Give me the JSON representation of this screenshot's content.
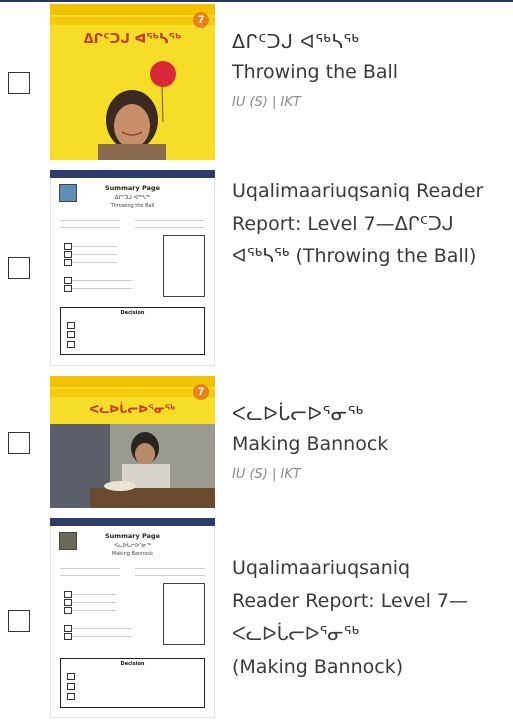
{
  "items": [
    {
      "kind": "book",
      "syllabics": "ᐃᒋᑦᑐᒍ ᐊᖅᓴᖅ",
      "title": "Throwing the Ball",
      "meta": "IU (S) | IKT",
      "cover_title": "ᐃᒋᑦᑐᒍ ᐊᖅᓴᖅ",
      "level": "7",
      "checked": false
    },
    {
      "kind": "report",
      "title": "Uqalimaariuqsaniq Reader Report: Level 7—ᐃᒋᑦᑐᒍ ᐊᖅᓴᖅ (Throwing the Ball)",
      "report_heading": "Summary Page",
      "report_syllabics": "ᐃᒋᑦᑐᒍ ᐊᖅᓴᖅ",
      "report_english": "Throwing the Ball",
      "decision_label": "Decision",
      "checked": false
    },
    {
      "kind": "book",
      "syllabics": "ᐸᓚᐅᒑᓕᐅᕐᓂᖅ",
      "title": "Making Bannock",
      "meta": "IU (S) | IKT",
      "cover_title": "ᐸᓚᐅᒑᓕᐅᕐᓂᖅ",
      "level": "7",
      "checked": false
    },
    {
      "kind": "report",
      "title": "Uqalimaariuqsaniq Reader Report: Level 7—ᐸᓚᐅᒑᓕᐅᕐᓂᖅ (Making Bannock)",
      "title_lines": [
        "Uqalimaariuqsaniq",
        "Reader Report: Level 7—",
        "ᐸᓚᐅᒑᓕᐅᕐᓂᖅ",
        "(Making Bannock)"
      ],
      "report_heading": "Summary Page",
      "report_syllabics": "ᐸᓚᐅᒑᓕᐅᕐᓂᖅ",
      "report_english": "Making Bannock",
      "decision_label": "Decision",
      "checked": false
    }
  ]
}
